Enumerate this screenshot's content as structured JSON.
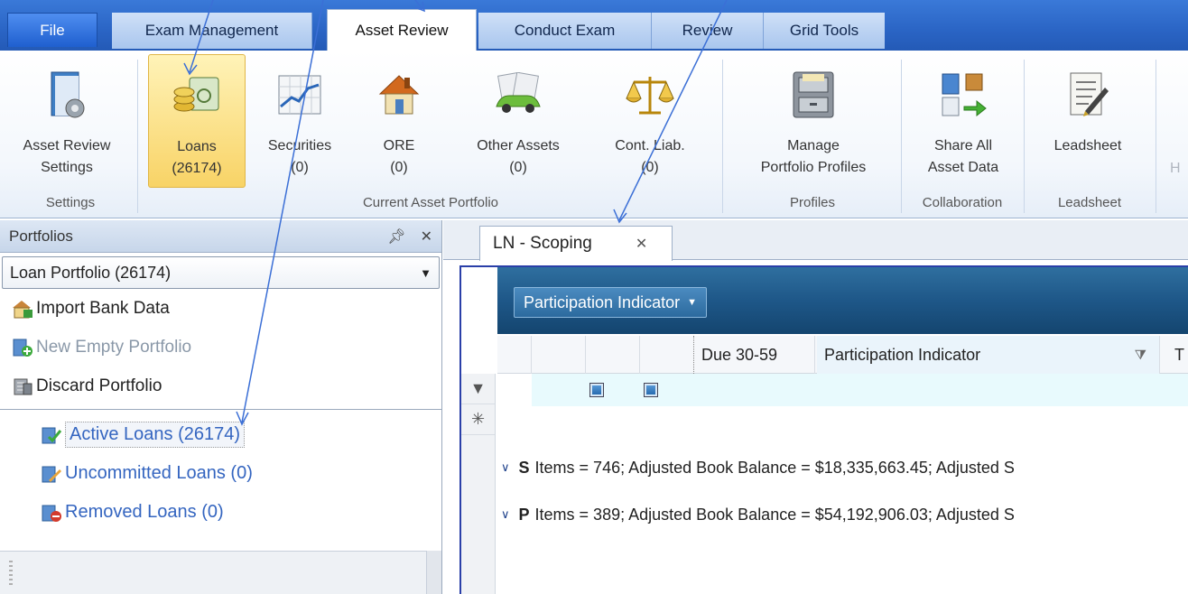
{
  "tabs": {
    "file": "File",
    "exam_management": "Exam Management",
    "asset_review": "Asset Review",
    "conduct_exam": "Conduct Exam",
    "review": "Review",
    "grid_tools": "Grid Tools"
  },
  "ribbon": {
    "settings_button": [
      "Asset Review",
      "Settings"
    ],
    "loans": [
      "Loans",
      "(26174)"
    ],
    "securities": [
      "Securities",
      "(0)"
    ],
    "ore": [
      "ORE",
      "(0)"
    ],
    "other_assets": [
      "Other Assets",
      "(0)"
    ],
    "cont_liab": [
      "Cont. Liab.",
      "(0)"
    ],
    "manage_profiles": [
      "Manage",
      "Portfolio Profiles"
    ],
    "share_all": [
      "Share All",
      "Asset Data"
    ],
    "leadsheet": [
      "Leadsheet"
    ],
    "cut_label": "H",
    "groups": {
      "settings": "Settings",
      "current_asset_portfolio": "Current Asset Portfolio",
      "profiles": "Profiles",
      "collaboration": "Collaboration",
      "leadsheet": "Leadsheet"
    }
  },
  "portfolios": {
    "title": "Portfolios",
    "pin_icon": "pin-icon",
    "close_icon": "close-icon",
    "selected": "Loan Portfolio (26174)",
    "actions": [
      "Import Bank Data",
      "New Empty Portfolio",
      "Discard Portfolio"
    ],
    "tree": [
      "Active Loans (26174)",
      "Uncommitted Loans (0)",
      "Removed Loans (0)"
    ]
  },
  "document": {
    "tab": "LN - Scoping",
    "group_chip": "Participation Indicator",
    "columns": [
      "Due 30-59",
      "Participation Indicator",
      "T"
    ],
    "groups": [
      {
        "key": "S",
        "text": "Items = 746; Adjusted Book Balance = $18,335,663.45;  Adjusted S"
      },
      {
        "key": "P",
        "text": "Items = 389; Adjusted Book Balance = $54,192,906.03;  Adjusted S"
      }
    ]
  }
}
